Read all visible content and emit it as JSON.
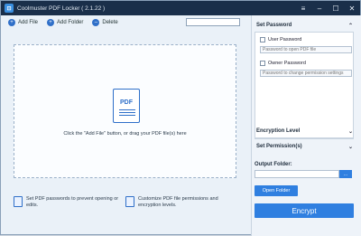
{
  "window": {
    "title": "Coolmuster PDF Locker  ( 2.1.22 )"
  },
  "toolbar": {
    "add_file": "Add File",
    "add_folder": "Add Folder",
    "delete": "Delete",
    "search_placeholder": ""
  },
  "dropzone": {
    "icon_text": "PDF",
    "hint": "Click the \"Add File\" button, or drag your PDF file(s) here"
  },
  "tips": [
    {
      "text": "Set PDF passwords to prevent opening or edits."
    },
    {
      "text": "Customize PDF file permissions and encryption levels."
    }
  ],
  "panel": {
    "set_password": "Set Password",
    "user_password": "User Password",
    "user_password_placeholder": "Password to open PDF file",
    "owner_password": "Owner Password",
    "owner_password_placeholder": "Password to change permission settings",
    "encryption_level": "Encryption Level",
    "set_permissions": "Set Permission(s)",
    "output_folder": "Output Folder:",
    "browse": "...",
    "open_folder": "Open Folder",
    "encrypt": "Encrypt"
  },
  "colors": {
    "accent": "#2f7fe0",
    "titlebar": "#1a2f4a"
  },
  "icons": {
    "up": "chevron-up-icon",
    "down": "chevron-down-icon"
  }
}
